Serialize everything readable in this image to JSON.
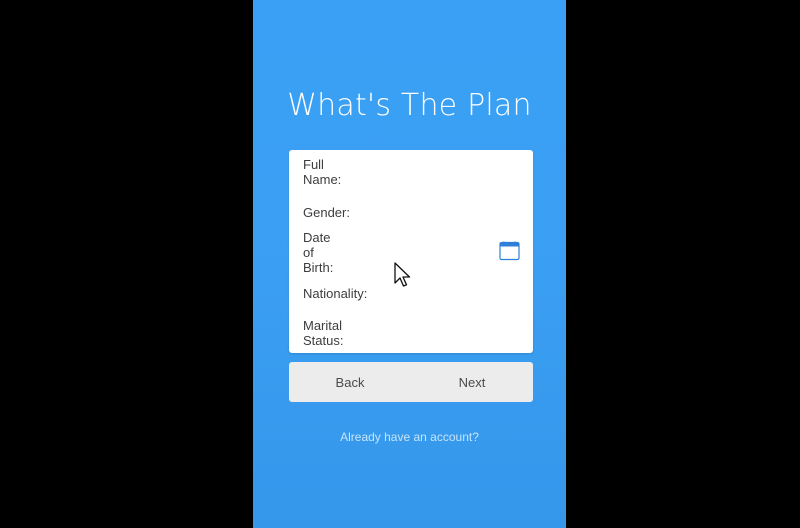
{
  "app": {
    "title": "What's The Plan"
  },
  "form": {
    "fields": [
      {
        "label": "Full Name:",
        "value": ""
      },
      {
        "label": "Gender:",
        "value": ""
      },
      {
        "label": "Date of Birth:",
        "value": ""
      },
      {
        "label": "Nationality:",
        "value": ""
      },
      {
        "label": "Marital Status:",
        "value": ""
      }
    ],
    "date_icon": "calendar-icon"
  },
  "buttons": {
    "back_label": "Back",
    "next_label": "Next"
  },
  "footer": {
    "account_link": "Already have an account?"
  },
  "colors": {
    "screen_background": "#3aa0f5",
    "card_background": "#ffffff",
    "button_bar_background": "#ececec",
    "link_color": "#c6e4fc"
  }
}
